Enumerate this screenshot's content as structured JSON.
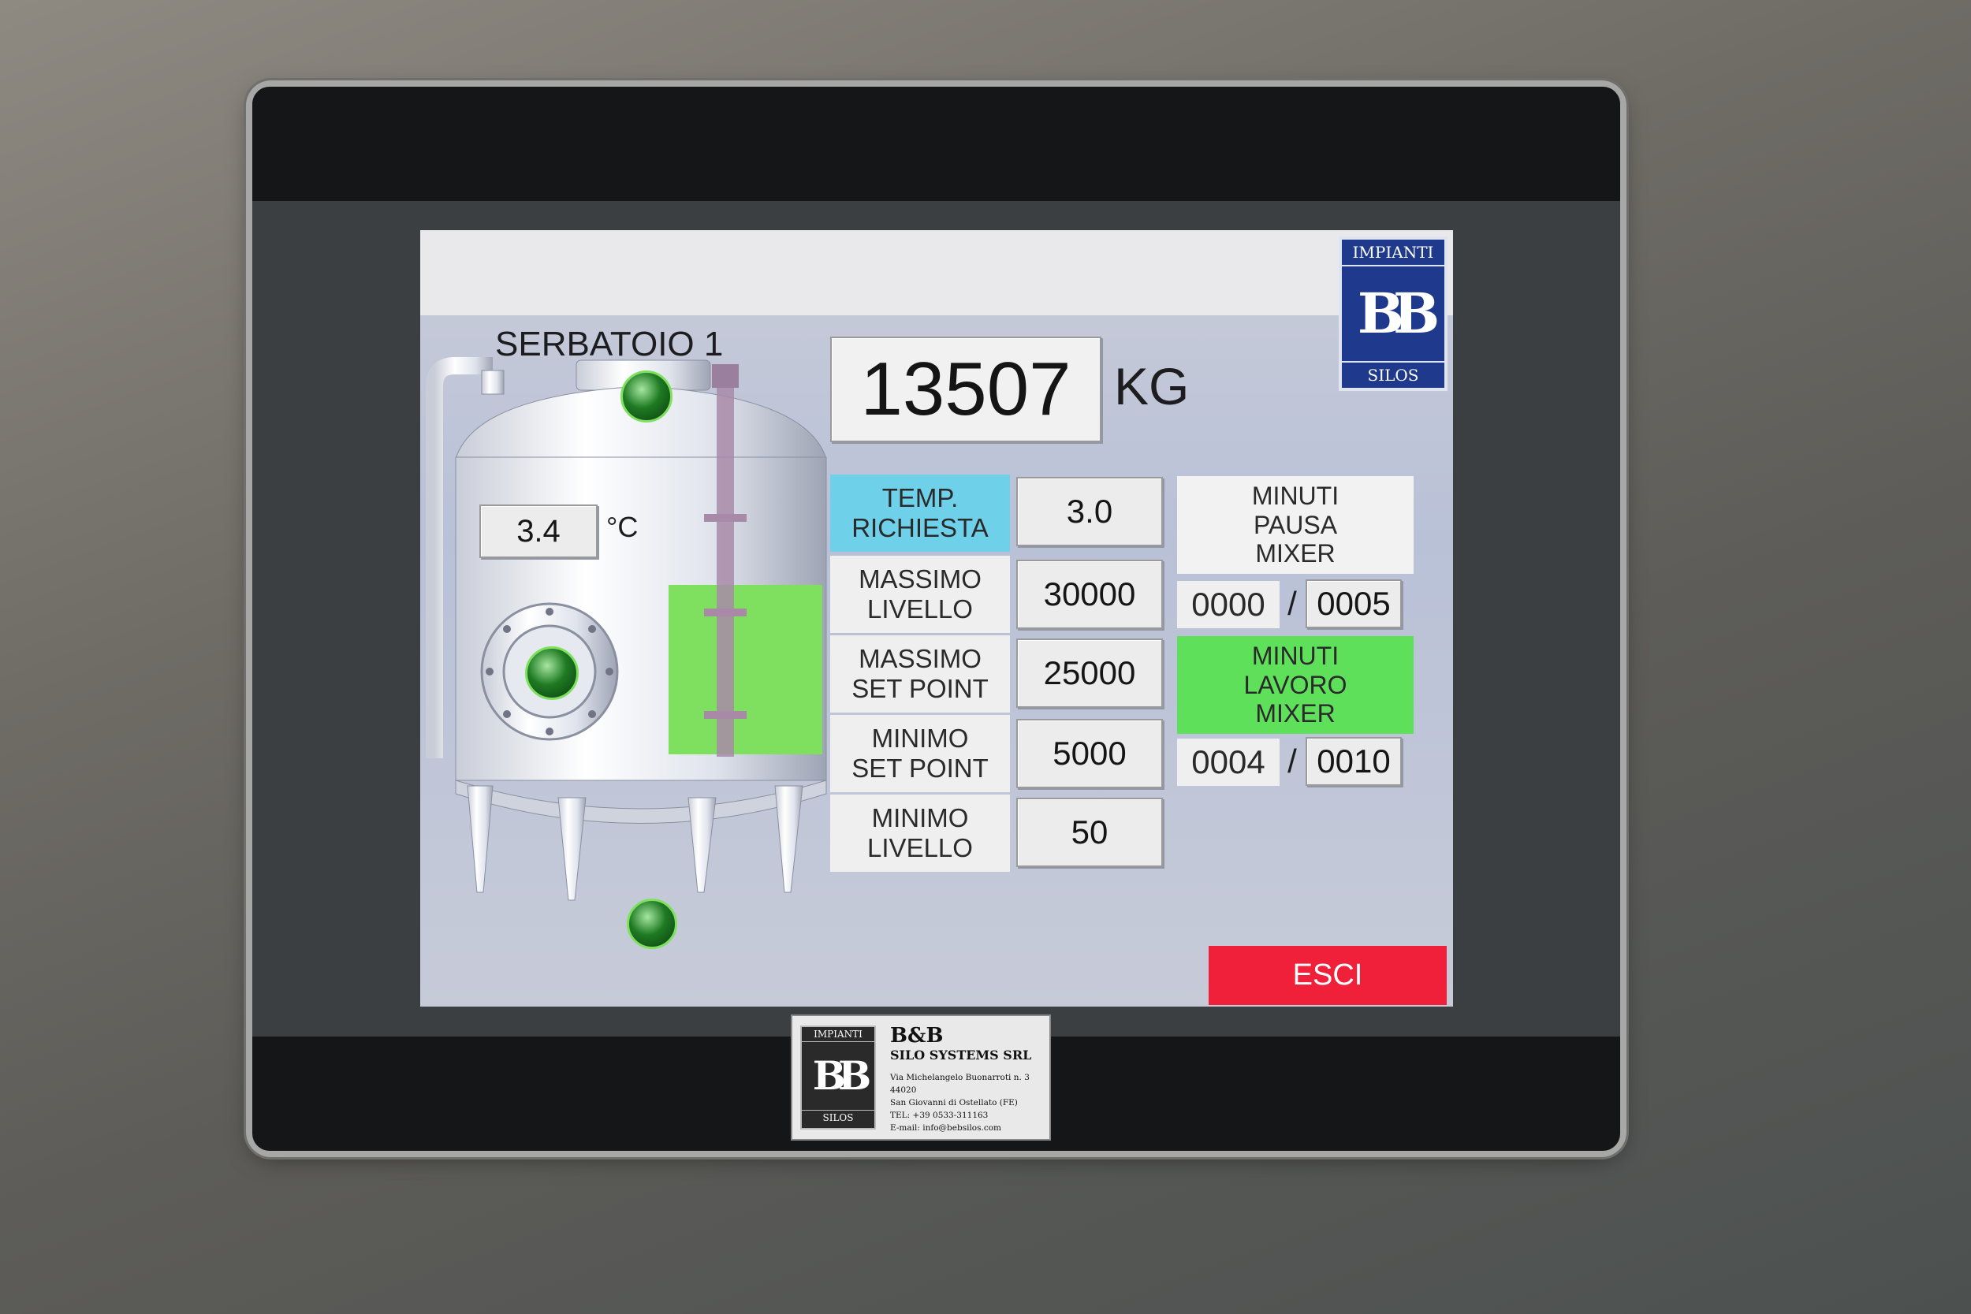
{
  "screen": {
    "tank_title": "SERBATOIO 1",
    "weight": {
      "value": "13507",
      "unit": "KG"
    },
    "temperature": {
      "value": "3.4",
      "unit": "°C"
    },
    "params": [
      {
        "label": "TEMP.\nRICHIESTA",
        "value": "3.0",
        "highlight": "#6fd0ea"
      },
      {
        "label": "MASSIMO\nLIVELLO",
        "value": "30000"
      },
      {
        "label": "MASSIMO\nSET POINT",
        "value": "25000"
      },
      {
        "label": "MINIMO\nSET POINT",
        "value": "5000"
      },
      {
        "label": "MINIMO\nLIVELLO",
        "value": "50"
      }
    ],
    "mixer_pause": {
      "label": "MINUTI\nPAUSA\nMIXER",
      "current": "0000",
      "separator": "/",
      "setpoint": "0005"
    },
    "mixer_work": {
      "label": "MINUTI\nLAVORO\nMIXER",
      "current": "0004",
      "separator": "/",
      "setpoint": "0010",
      "color": "#5fe05a"
    },
    "exit_button": {
      "label": "ESCI",
      "color": "#f0203a"
    },
    "logo": {
      "top": "IMPIANTI",
      "bottom": "SILOS",
      "mark": "BB"
    }
  },
  "nameplate": {
    "logo_top": "IMPIANTI",
    "logo_bottom": "SILOS",
    "company": "B&B",
    "company_sub": "SILO SYSTEMS SRL",
    "address_lines": [
      "Via Michelangelo Buonarroti n. 3",
      "44020",
      "San Giovanni di Ostellato (FE)",
      "TEL: +39 0533-311163",
      "E-mail: info@bebsilos.com"
    ]
  },
  "colors": {
    "level_fill": "#7ee05e",
    "indicator": "#1e7a22"
  }
}
